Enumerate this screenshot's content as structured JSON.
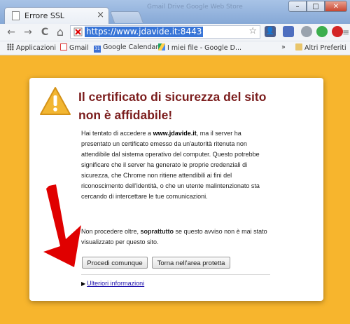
{
  "tab": {
    "title": "Errore SSL",
    "close": "×"
  },
  "window": {
    "minimize": "–",
    "maximize": "□",
    "close": "✕",
    "background_tab_text": "Gmail Drive  Google Web Store"
  },
  "toolbar": {
    "back": "←",
    "forward": "→",
    "reload": "C",
    "home": "⌂",
    "url": "https://www.jdavide.it:8443",
    "star": "☆"
  },
  "bookmarks": {
    "apps": "Applicazioni",
    "items": [
      "Gmail",
      "Google Calendar",
      "I miei file - Google D..."
    ],
    "overflow": "»",
    "other": "Altri Preferiti"
  },
  "icons": {
    "apps": "apps-grid-icon",
    "gmail": "gmail-icon",
    "calendar": "calendar-icon",
    "drive": "drive-icon",
    "folder": "folder-icon",
    "warning": "warning-triangle-icon",
    "security": "security-error-icon"
  },
  "calendar_icon_text": "31",
  "colors": {
    "background": "#f7b52d",
    "heading": "#7b1d1d",
    "link": "#1a0dab",
    "annotation_arrow": "#e00000"
  },
  "interstitial": {
    "heading": "Il certificato di sicurezza del sito non è affidabile!",
    "para1_prefix": "Hai tentato di accedere a ",
    "domain": "www.jdavide.it",
    "para1_rest": ", ma il server ha presentato un certificato emesso da un'autorità ritenuta non attendibile dal sistema operativo del computer. Questo potrebbe significare che il server ha generato le proprie credenziali di sicurezza, che Chrome non ritiene attendibili ai fini del riconoscimento dell'identità, o che un utente malintenzionato sta cercando di intercettare le tue comunicazioni.",
    "para2_prefix": "Non procedere oltre, ",
    "para2_bold": "soprattutto",
    "para2_rest": " se questo avviso non è mai stato visualizzato per questo sito.",
    "proceed_button": "Procedi comunque",
    "back_button": "Torna nell'area protetta",
    "more_info_arrow": "▶",
    "more_info": "Ulteriori informazioni"
  }
}
